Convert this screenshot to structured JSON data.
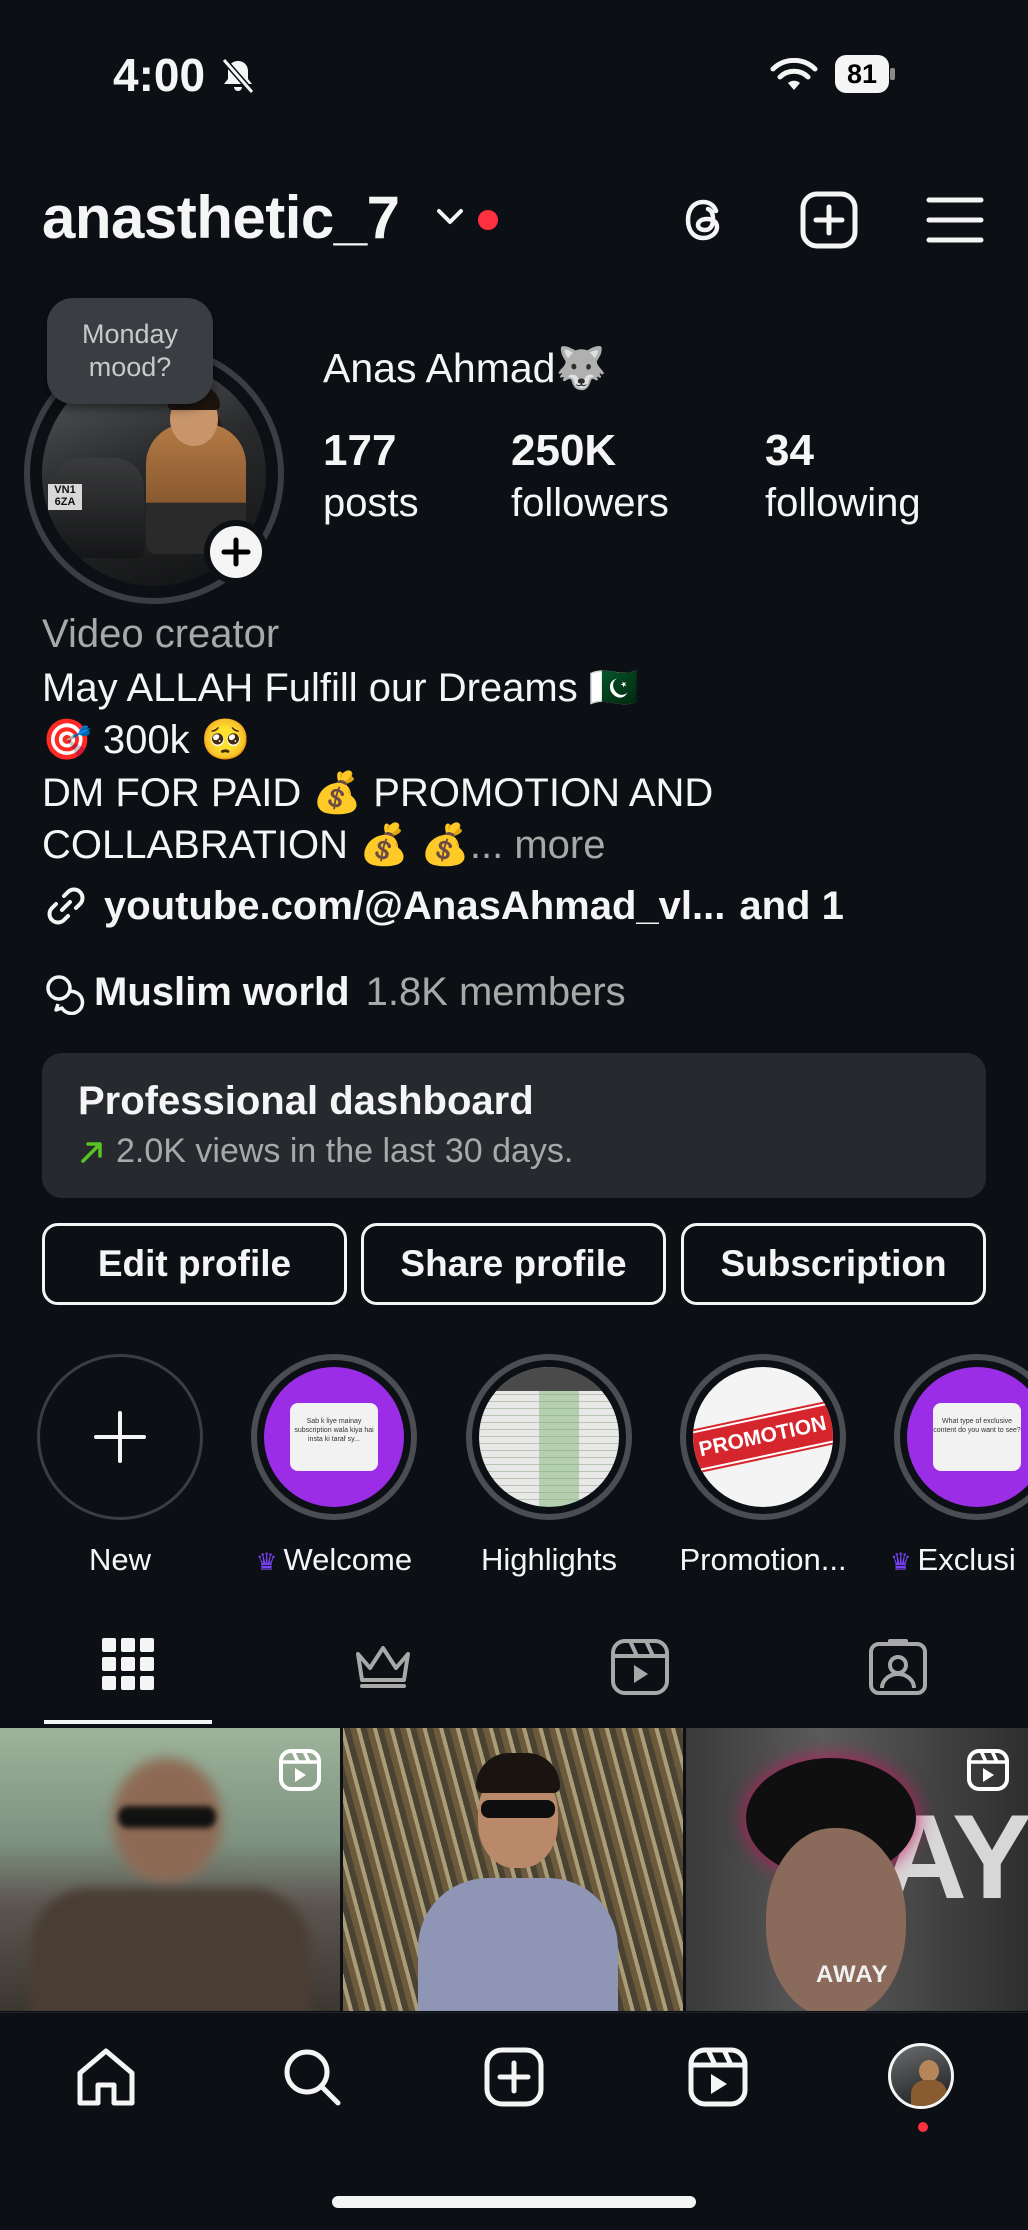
{
  "status_bar": {
    "time": "4:00",
    "battery": "81"
  },
  "header": {
    "username": "anasthetic_7"
  },
  "profile": {
    "note_line1": "Monday",
    "note_line2": "mood?",
    "avatar_plate": "VN1 6ZA",
    "display_name": "Anas Ahmad🐺",
    "stats": [
      {
        "value": "177",
        "label": "posts"
      },
      {
        "value": "250K",
        "label": "followers"
      },
      {
        "value": "34",
        "label": "following"
      }
    ]
  },
  "bio": {
    "category": "Video creator",
    "line1": "May ALLAH Fulfill our Dreams 🇵🇰",
    "line2": "🎯 300k 🥺",
    "line3": "DM FOR PAID 💰 PROMOTION AND",
    "line4": "COLLABRATION 💰 💰",
    "ellipsis": "...",
    "more": "more",
    "link": "youtube.com/@AnasAhmad_vl...",
    "link_more": "and 1",
    "channel_name": "Muslim world",
    "channel_members": "1.8K members"
  },
  "dashboard": {
    "title": "Professional dashboard",
    "subtitle": "2.0K views in the last 30 days."
  },
  "buttons": {
    "edit": "Edit profile",
    "share": "Share profile",
    "subscription": "Subscription"
  },
  "highlights": [
    {
      "label": "New"
    },
    {
      "label": "Welcome",
      "exclusive": true,
      "card_text": "Sab k liye mainay subscription wala kiya hai insta ki taraf sy..."
    },
    {
      "label": "Highlights"
    },
    {
      "label": "Promotion...",
      "sticker": "PROMOTION"
    },
    {
      "label": "Exclusi",
      "exclusive": true,
      "card_text": "What type of exclusive content do you want to see?"
    }
  ],
  "grid": [
    {
      "reel": true
    },
    {
      "reel": false
    },
    {
      "reel": true,
      "overlay_text": "AWAY"
    }
  ],
  "colors": {
    "background": "#0c1014",
    "text": "#f5f5f5",
    "secondary_text": "#a8a8a8",
    "notification": "#ff3040",
    "exclusive": "#7b42f6",
    "trend": "#58c322"
  },
  "nav": [
    "home-icon",
    "search-icon",
    "create-icon",
    "reels-icon",
    "profile-avatar"
  ]
}
